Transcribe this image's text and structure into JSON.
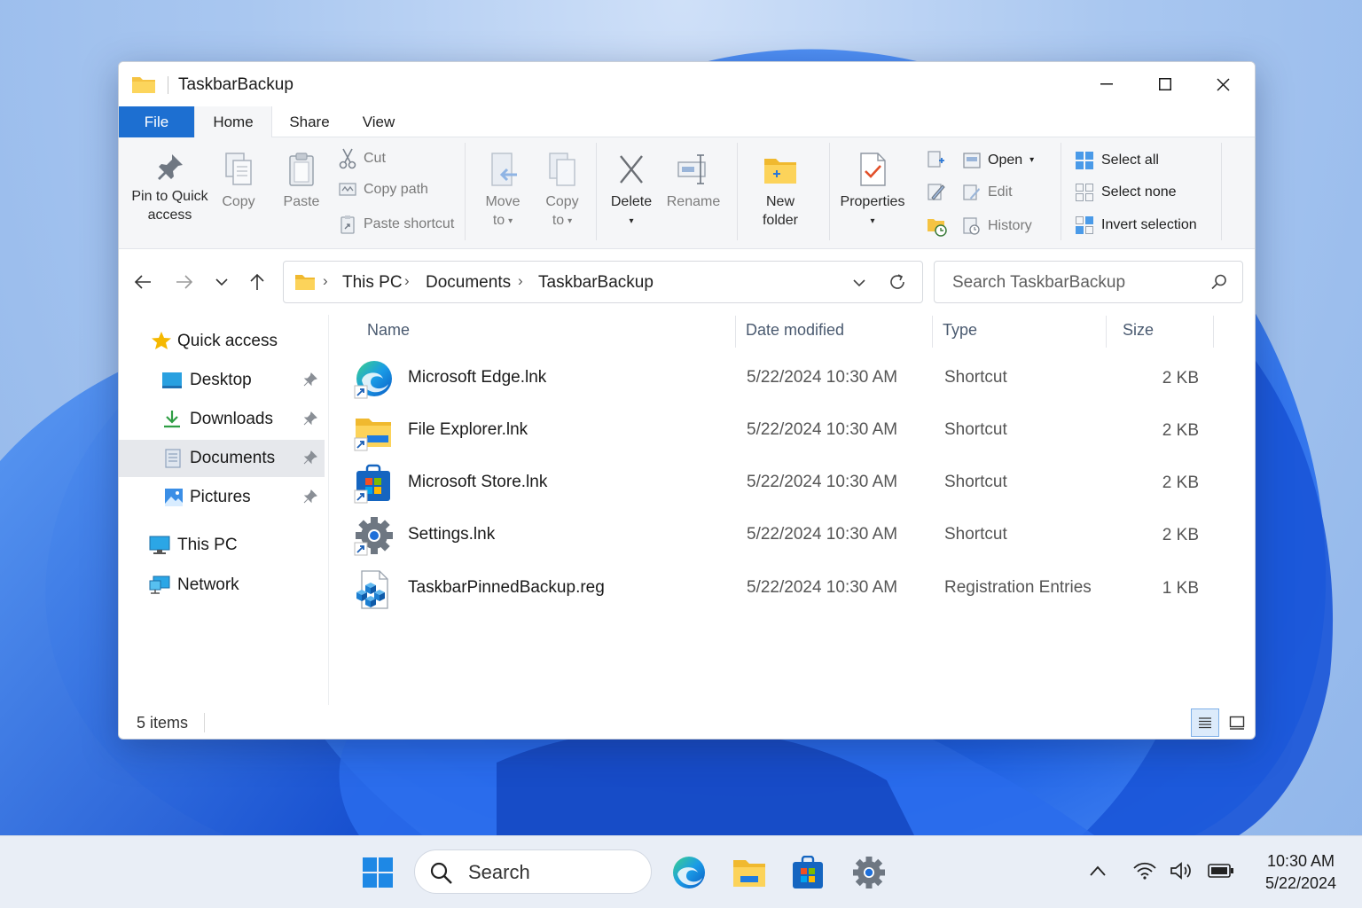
{
  "window": {
    "title": "TaskbarBackup"
  },
  "ribbon": {
    "tabs": [
      "File",
      "Home",
      "Share",
      "View"
    ],
    "clipboard": {
      "pin_line1": "Pin to Quick",
      "pin_line2": "access",
      "copy": "Copy",
      "paste": "Paste",
      "cut": "Cut",
      "copy_path": "Copy path",
      "paste_shortcut": "Paste shortcut"
    },
    "organize": {
      "move_line1": "Move",
      "move_line2": "to",
      "copy_line1": "Copy",
      "copy_line2": "to",
      "delete": "Delete",
      "rename": "Rename"
    },
    "new": {
      "new_folder_line1": "New",
      "new_folder_line2": "folder"
    },
    "open": {
      "properties": "Properties",
      "open": "Open",
      "edit": "Edit",
      "history": "History"
    },
    "select": {
      "select_all": "Select all",
      "select_none": "Select none",
      "invert_selection": "Invert selection"
    }
  },
  "address": {
    "crumbs": [
      "This PC",
      "Documents",
      "TaskbarBackup"
    ],
    "search_placeholder": "Search TaskbarBackup"
  },
  "nav_pane": {
    "items": [
      {
        "label": "Quick access",
        "icon": "star-icon"
      },
      {
        "label": "Desktop",
        "icon": "desktop-icon",
        "pinned": true
      },
      {
        "label": "Downloads",
        "icon": "download-icon",
        "pinned": true
      },
      {
        "label": "Documents",
        "icon": "documents-icon",
        "pinned": true,
        "selected": true
      },
      {
        "label": "Pictures",
        "icon": "pictures-icon",
        "pinned": true
      },
      {
        "label": "This PC",
        "icon": "monitor-icon"
      },
      {
        "label": "Network",
        "icon": "network-icon"
      }
    ]
  },
  "file_list": {
    "columns": [
      "Name",
      "Date modified",
      "Type",
      "Size"
    ],
    "rows": [
      {
        "name": "Microsoft Edge.lnk",
        "date": "5/22/2024 10:30 AM",
        "type": "Shortcut",
        "size": "2 KB",
        "icon": "edge-shortcut-icon"
      },
      {
        "name": "File Explorer.lnk",
        "date": "5/22/2024 10:30 AM",
        "type": "Shortcut",
        "size": "2 KB",
        "icon": "file-explorer-shortcut-icon"
      },
      {
        "name": "Microsoft Store.lnk",
        "date": "5/22/2024 10:30 AM",
        "type": "Shortcut",
        "size": "2 KB",
        "icon": "store-shortcut-icon"
      },
      {
        "name": "Settings.lnk",
        "date": "5/22/2024 10:30 AM",
        "type": "Shortcut",
        "size": "2 KB",
        "icon": "settings-shortcut-icon"
      },
      {
        "name": "TaskbarPinnedBackup.reg",
        "date": "5/22/2024 10:30 AM",
        "type": "Registration Entries",
        "size": "1 KB",
        "icon": "registry-file-icon"
      }
    ]
  },
  "status": {
    "item_count": "5 items"
  },
  "taskbar": {
    "search_label": "Search",
    "time": "10:30 AM",
    "date": "5/22/2024"
  },
  "colors": {
    "accent": "#1d6fd1",
    "selection": "#e6e8ec",
    "wallpaper_blue": "#1e5fe0"
  }
}
